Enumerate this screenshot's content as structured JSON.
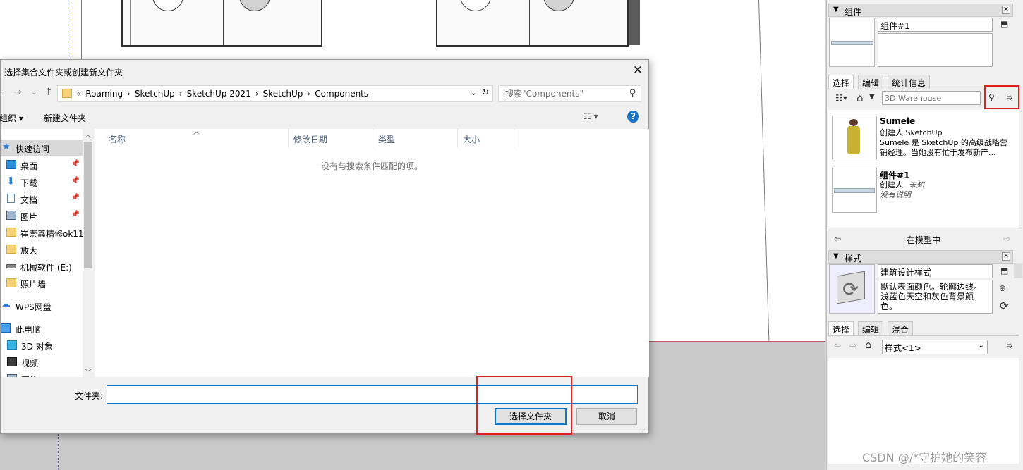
{
  "dialog": {
    "title": "选择集合文件夹或创建新文件夹",
    "breadcrumb": [
      "Roaming",
      "SketchUp",
      "SketchUp 2021",
      "SketchUp",
      "Components"
    ],
    "breadcrumb_prefix": "«",
    "search_placeholder": "搜索\"Components\"",
    "organize_label": "组织 ▾",
    "new_folder_label": "新建文件夹",
    "nav_items": [
      {
        "label": "快速访问",
        "icon": "star-icon",
        "selected": true
      },
      {
        "label": "桌面",
        "icon": "desktop-icon",
        "pinned": true
      },
      {
        "label": "下载",
        "icon": "download-icon",
        "pinned": true
      },
      {
        "label": "文档",
        "icon": "document-icon",
        "pinned": true
      },
      {
        "label": "图片",
        "icon": "picture-icon",
        "pinned": true
      },
      {
        "label": "崔崇鑫精修ok11",
        "icon": "folder-icon"
      },
      {
        "label": "放大",
        "icon": "folder-icon"
      },
      {
        "label": "机械软件 (E:)",
        "icon": "drive-icon"
      },
      {
        "label": "照片墙",
        "icon": "folder-icon"
      },
      {
        "label": "WPS网盘",
        "icon": "cloud-icon"
      },
      {
        "label": "此电脑",
        "icon": "computer-icon"
      },
      {
        "label": "3D 对象",
        "icon": "cube-icon"
      },
      {
        "label": "视频",
        "icon": "video-icon"
      },
      {
        "label": "图片",
        "icon": "picture-icon"
      }
    ],
    "columns": [
      "名称",
      "修改日期",
      "类型",
      "大小"
    ],
    "empty_message": "没有与搜索条件匹配的项。",
    "folder_label": "文件夹:",
    "folder_value": "",
    "select_folder_button": "选择文件夹",
    "cancel_button": "取消"
  },
  "components": {
    "tray_title": "组件",
    "name_value": "组件#1",
    "tabs": [
      "选择",
      "编辑",
      "统计信息"
    ],
    "search_placeholder": "3D Warehouse",
    "items": [
      {
        "name": "Sumele",
        "line1": "创建人 SketchUp",
        "line2": "Sumele 是 SketchUp 的高级战略营",
        "line3": "销经理。当她没有忙于发布新产..."
      },
      {
        "name": "组件#1",
        "line1": "创建人",
        "line1_italic": "未知",
        "line2_italic": "没有说明"
      }
    ],
    "in_model_label": "在模型中"
  },
  "styles": {
    "tray_title": "样式",
    "name_value": "建筑设计样式",
    "description": "默认表面颜色。轮廓边线。浅蓝色天空和灰色背景颜色。",
    "tabs": [
      "选择",
      "编辑",
      "混合"
    ],
    "dropdown_value": "样式<1>"
  },
  "watermark": "CSDN @/*守护她的笑容",
  "colors": {
    "accent": "#0b78d0",
    "highlight_box": "#e02020"
  }
}
